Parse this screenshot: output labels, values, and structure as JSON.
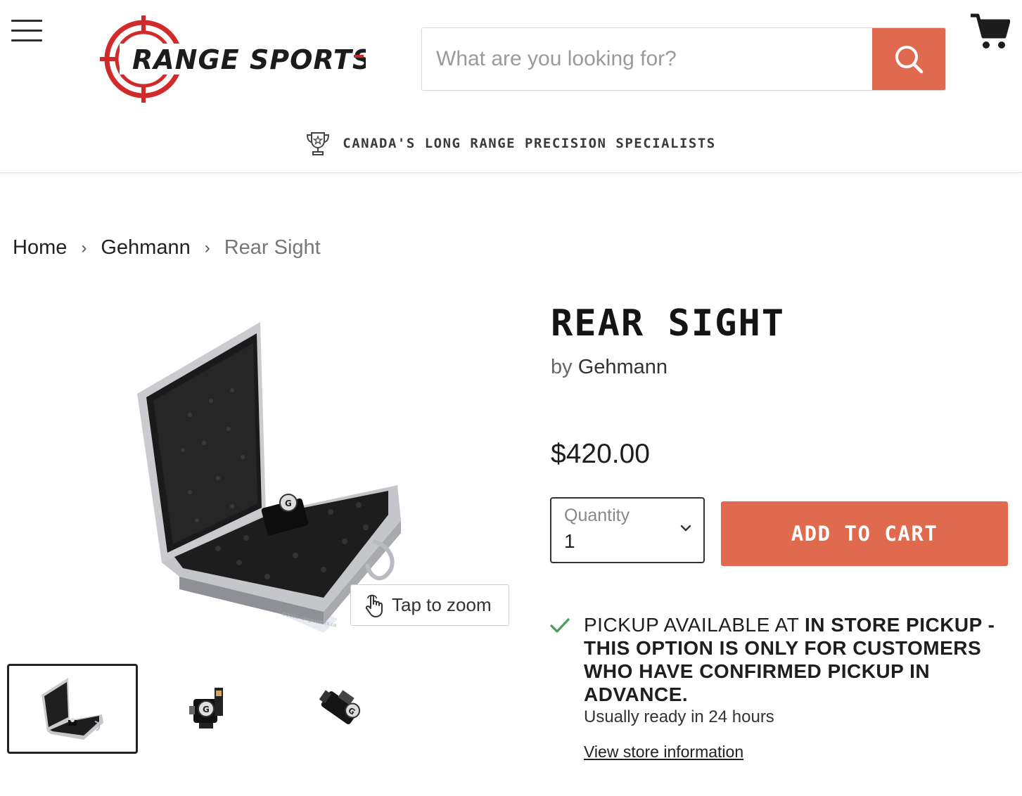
{
  "header": {
    "brand_name": "RANGE SPORTS",
    "search_placeholder": "What are you looking for?",
    "tagline": "CANADA'S LONG RANGE PRECISION SPECIALISTS",
    "accent_color": "#e06a4e",
    "logo_color": "#d12a2a"
  },
  "breadcrumb": {
    "items": [
      "Home",
      "Gehmann",
      "Rear Sight"
    ]
  },
  "gallery": {
    "zoom_label": "Tap to zoom",
    "watermark": "©2021 rangesports.ca",
    "thumb_count": 3,
    "active_thumb": 1
  },
  "product": {
    "title": "REAR SIGHT",
    "vendor_prefix": "by",
    "vendor": "Gehmann",
    "price": "$420.00",
    "quantity_label": "Quantity",
    "quantity_value": "1",
    "add_to_cart": "ADD TO CART"
  },
  "pickup": {
    "prefix": "Pickup available at",
    "location": "In Store Pickup - This Option is ONLY for Customers who have Confirmed Pickup in Advance.",
    "ready_time": "Usually ready in 24 hours",
    "store_link": "View store information",
    "check_color": "#4a9d5b"
  }
}
